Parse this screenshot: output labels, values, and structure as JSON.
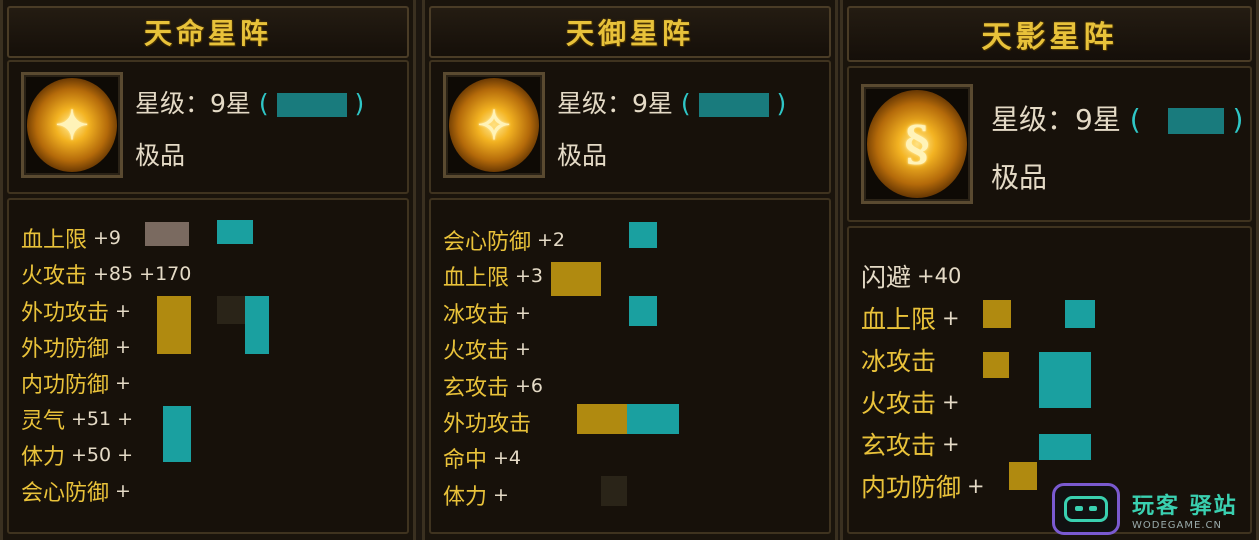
{
  "panels": [
    {
      "title": "天命星阵",
      "grade_label": "星级：9星",
      "paren_open": "(",
      "paren_close": ")",
      "quality": "极品",
      "icon": "star-formation-icon",
      "stats": [
        {
          "name": "血上限",
          "value": "+9"
        },
        {
          "name": "火攻击",
          "value": "+85 +170"
        },
        {
          "name": "外功攻击",
          "value": "+"
        },
        {
          "name": "外功防御",
          "value": "+"
        },
        {
          "name": "内功防御",
          "value": "+"
        },
        {
          "name": "灵气",
          "value": "+51 +"
        },
        {
          "name": "体力",
          "value": "+50 +"
        },
        {
          "name": "会心防御",
          "value": "+"
        }
      ]
    },
    {
      "title": "天御星阵",
      "grade_label": "星级：9星",
      "paren_open": "(",
      "paren_close": ")",
      "quality": "极品",
      "icon": "star-formation-icon",
      "stats": [
        {
          "name": "会心防御",
          "value": "+2"
        },
        {
          "name": "血上限",
          "value": "+3"
        },
        {
          "name": "冰攻击",
          "value": "+"
        },
        {
          "name": "火攻击",
          "value": "+"
        },
        {
          "name": "玄攻击",
          "value": "+6"
        },
        {
          "name": "外功攻击",
          "value": ""
        },
        {
          "name": "命中",
          "value": "+4"
        },
        {
          "name": "体力",
          "value": "+"
        }
      ]
    },
    {
      "title": "天影星阵",
      "grade_label": "星级：9星",
      "paren_open": "(",
      "paren_close": ")",
      "quality": "极品",
      "icon": "dragon-formation-icon",
      "stats": [
        {
          "name": "闪避",
          "value": "+40"
        },
        {
          "name": "血上限",
          "value": "+"
        },
        {
          "name": "冰攻击",
          "value": ""
        },
        {
          "name": "火攻击",
          "value": "+"
        },
        {
          "name": "玄攻击",
          "value": "+"
        },
        {
          "name": "内功防御",
          "value": "+"
        }
      ]
    }
  ],
  "watermark": {
    "cn": "玩客 驿站",
    "en": "WODEGAME.CN"
  },
  "colors": {
    "stat_name": "#e9c23a",
    "title": "#e8c23a",
    "accent_cyan": "#2fc6c6"
  }
}
